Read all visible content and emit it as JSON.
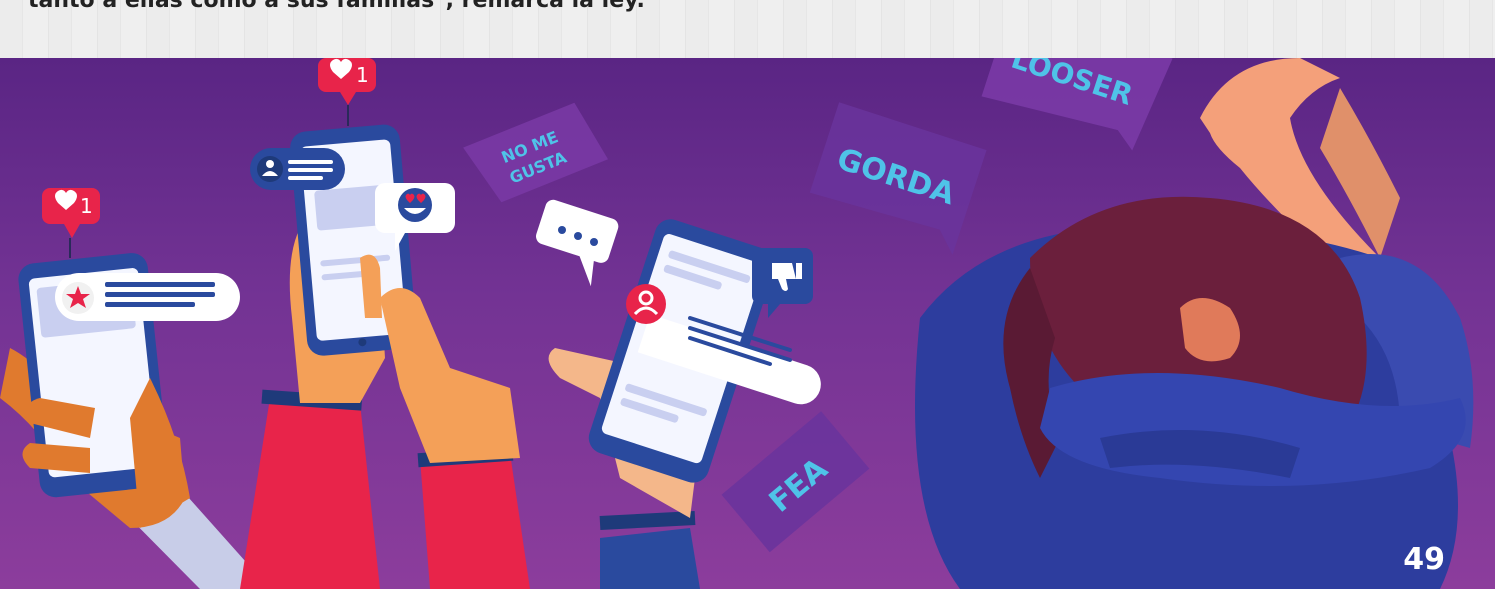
{
  "caption": "tanto a ellas como a sus familias\", remarca la ley.",
  "like_badges": [
    "1",
    "1"
  ],
  "word_tags": {
    "no_me_line1": "NO ME",
    "no_me_line2": "GUSTA",
    "gorda": "GORDA",
    "looser": "LOOSER",
    "fea": "FEA"
  },
  "page_number": "49",
  "colors": {
    "background_top": "#5a2584",
    "background_bottom": "#8c3d9c",
    "like_badge": "#e8244a",
    "tag_text": "#4fc3e8",
    "phone_body": "#2a4a9e"
  },
  "icons": [
    "heart-icon",
    "star-icon",
    "user-icon",
    "heart-eyes-emoji-icon",
    "ellipsis-icon",
    "thumbs-down-icon"
  ]
}
